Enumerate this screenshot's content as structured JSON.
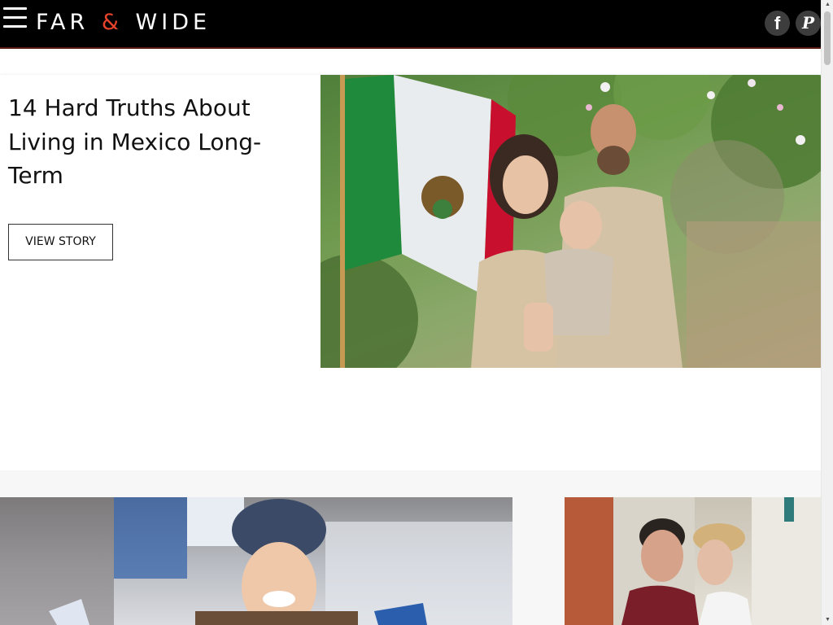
{
  "header": {
    "logo_left": "FAR",
    "logo_amp": "&",
    "logo_right": "WIDE",
    "menu_icon": "hamburger-icon",
    "social": [
      {
        "name": "facebook",
        "icon": "facebook-icon",
        "glyph": "f"
      },
      {
        "name": "pinterest",
        "icon": "pinterest-icon",
        "glyph": "P"
      }
    ]
  },
  "featured": {
    "title": "14 Hard Truths About Living in Mexico Long-Term",
    "button_label": "VIEW STORY"
  },
  "colors": {
    "header_bg": "#000000",
    "brand_accent": "#e8432c",
    "button_border": "#333333"
  }
}
